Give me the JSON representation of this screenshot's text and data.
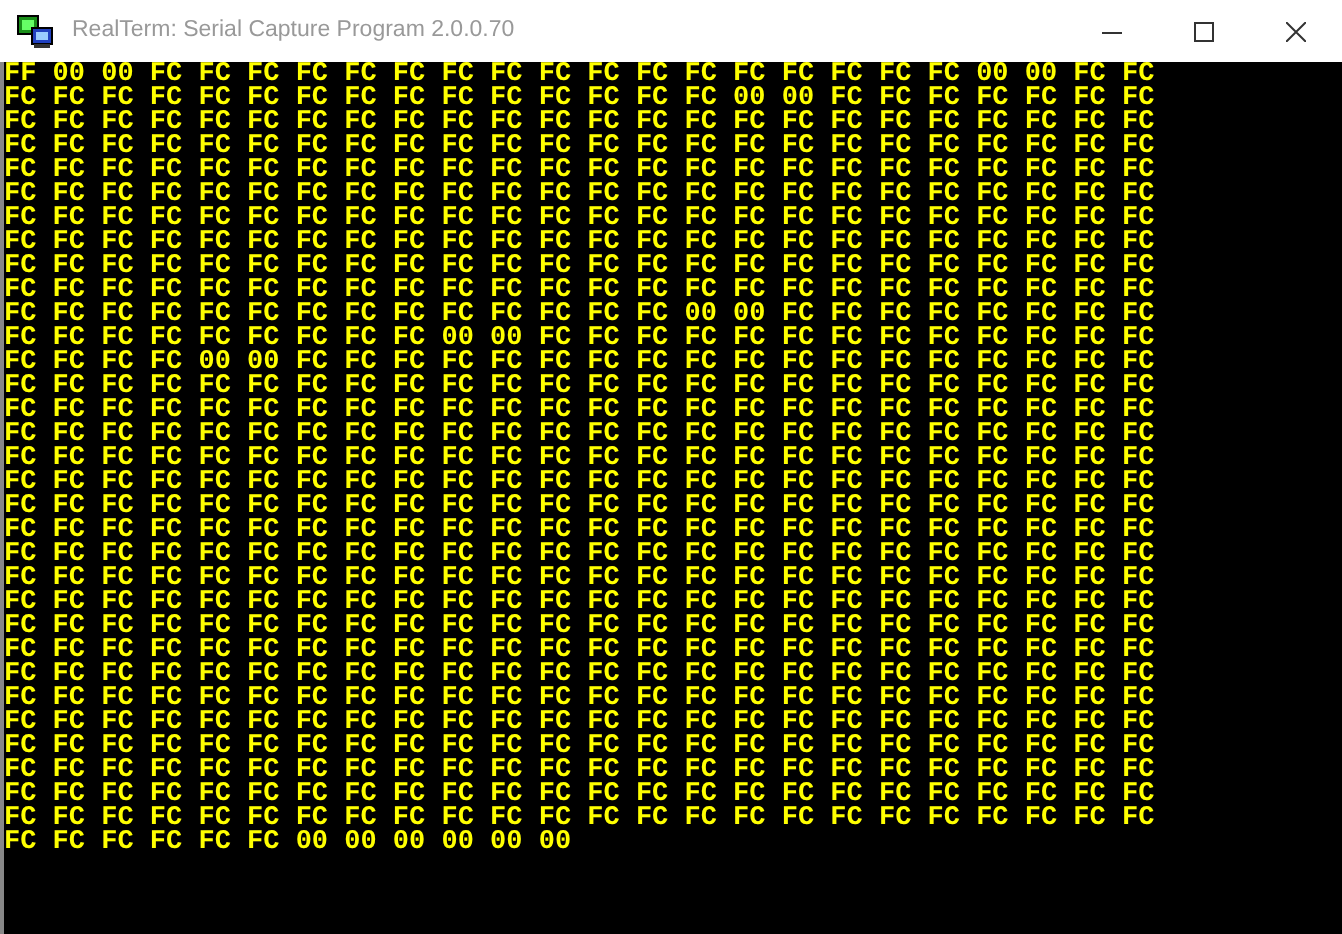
{
  "window": {
    "title": "RealTerm: Serial Capture Program 2.0.0.70"
  },
  "terminal": {
    "lines": [
      "FF 00 00 FC FC FC FC FC FC FC FC FC FC FC FC FC FC FC FC FC 00 00 FC FC",
      "FC FC FC FC FC FC FC FC FC FC FC FC FC FC FC 00 00 FC FC FC FC FC FC FC",
      "FC FC FC FC FC FC FC FC FC FC FC FC FC FC FC FC FC FC FC FC FC FC FC FC",
      "FC FC FC FC FC FC FC FC FC FC FC FC FC FC FC FC FC FC FC FC FC FC FC FC",
      "FC FC FC FC FC FC FC FC FC FC FC FC FC FC FC FC FC FC FC FC FC FC FC FC",
      "FC FC FC FC FC FC FC FC FC FC FC FC FC FC FC FC FC FC FC FC FC FC FC FC",
      "FC FC FC FC FC FC FC FC FC FC FC FC FC FC FC FC FC FC FC FC FC FC FC FC",
      "FC FC FC FC FC FC FC FC FC FC FC FC FC FC FC FC FC FC FC FC FC FC FC FC",
      "FC FC FC FC FC FC FC FC FC FC FC FC FC FC FC FC FC FC FC FC FC FC FC FC",
      "FC FC FC FC FC FC FC FC FC FC FC FC FC FC FC FC FC FC FC FC FC FC FC FC",
      "FC FC FC FC FC FC FC FC FC FC FC FC FC FC 00 00 FC FC FC FC FC FC FC FC",
      "FC FC FC FC FC FC FC FC FC 00 00 FC FC FC FC FC FC FC FC FC FC FC FC FC",
      "FC FC FC FC 00 00 FC FC FC FC FC FC FC FC FC FC FC FC FC FC FC FC FC FC",
      "FC FC FC FC FC FC FC FC FC FC FC FC FC FC FC FC FC FC FC FC FC FC FC FC",
      "FC FC FC FC FC FC FC FC FC FC FC FC FC FC FC FC FC FC FC FC FC FC FC FC",
      "FC FC FC FC FC FC FC FC FC FC FC FC FC FC FC FC FC FC FC FC FC FC FC FC",
      "FC FC FC FC FC FC FC FC FC FC FC FC FC FC FC FC FC FC FC FC FC FC FC FC",
      "FC FC FC FC FC FC FC FC FC FC FC FC FC FC FC FC FC FC FC FC FC FC FC FC",
      "FC FC FC FC FC FC FC FC FC FC FC FC FC FC FC FC FC FC FC FC FC FC FC FC",
      "FC FC FC FC FC FC FC FC FC FC FC FC FC FC FC FC FC FC FC FC FC FC FC FC",
      "FC FC FC FC FC FC FC FC FC FC FC FC FC FC FC FC FC FC FC FC FC FC FC FC",
      "FC FC FC FC FC FC FC FC FC FC FC FC FC FC FC FC FC FC FC FC FC FC FC FC",
      "FC FC FC FC FC FC FC FC FC FC FC FC FC FC FC FC FC FC FC FC FC FC FC FC",
      "FC FC FC FC FC FC FC FC FC FC FC FC FC FC FC FC FC FC FC FC FC FC FC FC",
      "FC FC FC FC FC FC FC FC FC FC FC FC FC FC FC FC FC FC FC FC FC FC FC FC",
      "FC FC FC FC FC FC FC FC FC FC FC FC FC FC FC FC FC FC FC FC FC FC FC FC",
      "FC FC FC FC FC FC FC FC FC FC FC FC FC FC FC FC FC FC FC FC FC FC FC FC",
      "FC FC FC FC FC FC FC FC FC FC FC FC FC FC FC FC FC FC FC FC FC FC FC FC",
      "FC FC FC FC FC FC FC FC FC FC FC FC FC FC FC FC FC FC FC FC FC FC FC FC",
      "FC FC FC FC FC FC FC FC FC FC FC FC FC FC FC FC FC FC FC FC FC FC FC FC",
      "FC FC FC FC FC FC FC FC FC FC FC FC FC FC FC FC FC FC FC FC FC FC FC FC",
      "FC FC FC FC FC FC FC FC FC FC FC FC FC FC FC FC FC FC FC FC FC FC FC FC",
      "FC FC FC FC FC FC 00 00 00 00 00 00"
    ]
  }
}
